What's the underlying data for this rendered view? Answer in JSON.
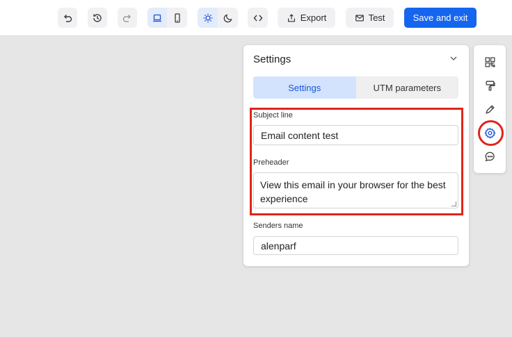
{
  "toolbar": {
    "export_label": "Export",
    "test_label": "Test",
    "save_exit_label": "Save and exit"
  },
  "settings_panel": {
    "title": "Settings",
    "tabs": [
      {
        "label": "Settings",
        "active": true
      },
      {
        "label": "UTM parameters",
        "active": false
      }
    ],
    "subject_line": {
      "label": "Subject line",
      "value": "Email content test"
    },
    "preheader": {
      "label": "Preheader",
      "value": "View this email in your browser for the best experience"
    },
    "senders_name": {
      "label": "Senders name",
      "value": "alenparf"
    }
  },
  "side_tools": [
    "qr-code-icon",
    "paint-roller-icon",
    "pencil-icon",
    "gear-icon",
    "chat-bubble-icon"
  ],
  "colors": {
    "primary": "#1565ef",
    "active_tab": "#d3e3fd",
    "highlight": "#e0241b"
  }
}
